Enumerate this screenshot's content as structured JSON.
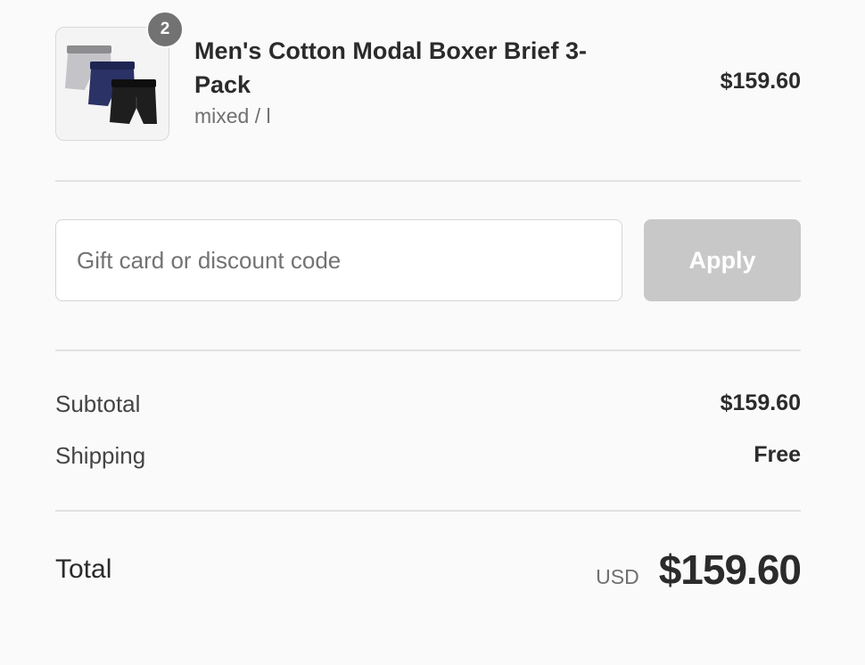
{
  "cart_item": {
    "quantity": "2",
    "title": "Men's Cotton Modal Boxer Brief 3-Pack",
    "variant": "mixed / l",
    "price": "$159.60",
    "image_icon": "boxer-briefs-product-image",
    "image_colors": [
      "#b9b9bd",
      "#2b3161",
      "#1b1b1b"
    ]
  },
  "discount": {
    "placeholder": "Gift card or discount code",
    "value": "",
    "apply_label": "Apply"
  },
  "summary": {
    "subtotal_label": "Subtotal",
    "subtotal_value": "$159.60",
    "shipping_label": "Shipping",
    "shipping_value": "Free"
  },
  "total": {
    "label": "Total",
    "currency": "USD",
    "amount": "$159.60"
  },
  "colors": {
    "background": "#fafafa",
    "badge": "#727272",
    "apply_disabled": "#c8c8c8",
    "divider": "#e1e1e1"
  }
}
